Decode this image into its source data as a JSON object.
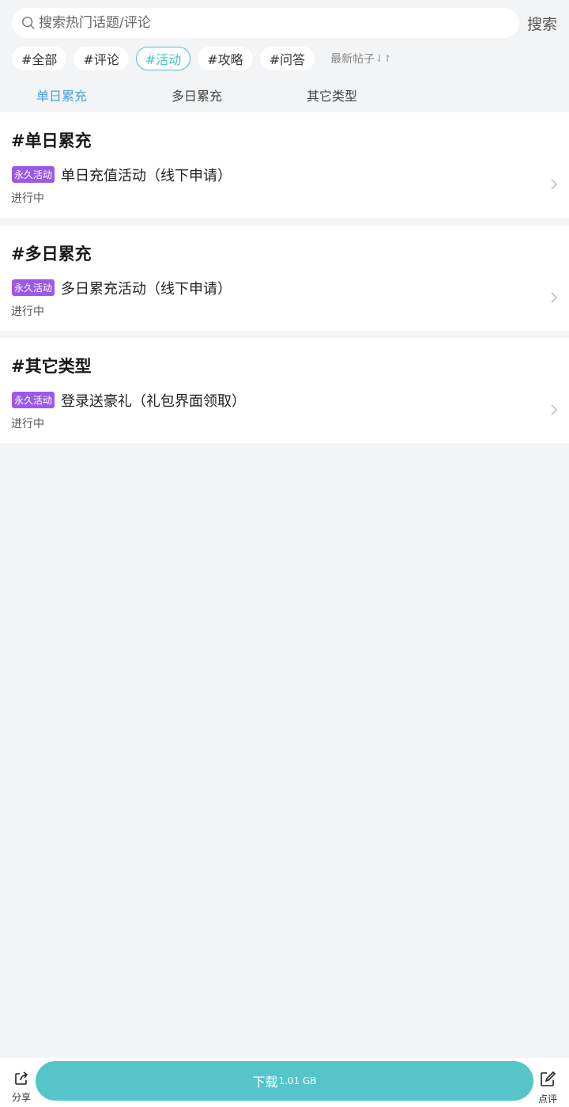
{
  "search": {
    "placeholder": "搜索热门话题/评论",
    "value": "",
    "button": "搜索"
  },
  "chips": [
    "#全部",
    "#评论",
    "#活动",
    "#攻略",
    "#问答"
  ],
  "active_chip": "#活动",
  "sort": {
    "label": "最新帖子",
    "icon": "sort-arrows-icon"
  },
  "subtabs": [
    "单日累充",
    "多日累充",
    "其它类型"
  ],
  "sections": [
    {
      "title": "#单日累充",
      "item": {
        "badge": "永久活动",
        "title": "单日充值活动（线下申请）",
        "status": "进行中"
      }
    },
    {
      "title": "#多日累充",
      "item": {
        "badge": "永久活动",
        "title": "多日累充活动（线下申请）",
        "status": "进行中"
      }
    },
    {
      "title": "#其它类型",
      "item": {
        "badge": "永久活动",
        "title": "登录送豪礼（礼包界面领取）",
        "status": "进行中"
      }
    }
  ],
  "bottom": {
    "share_label": "分享",
    "download_label": "下载",
    "download_size": "1.01 GB",
    "review_label": "点评"
  },
  "colors": {
    "accent": "#4fc0c8",
    "tab_active": "#4a9fe0",
    "badge": "#9b59e6",
    "download": "#55c5ca"
  }
}
